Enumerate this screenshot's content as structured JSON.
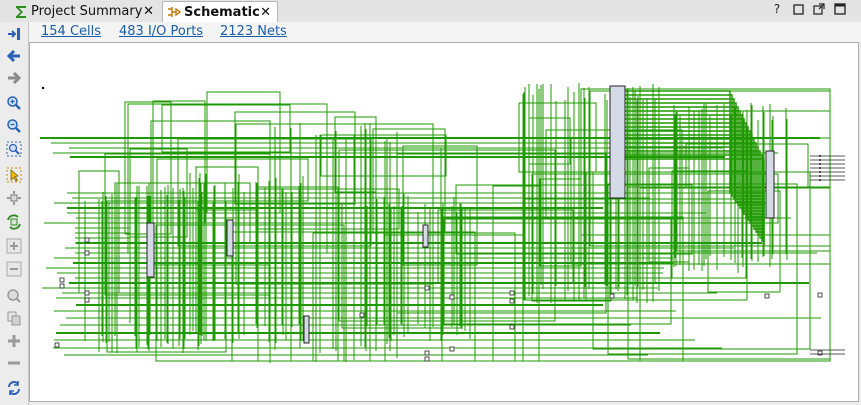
{
  "tabs": [
    {
      "label": "Project Summary",
      "icon": "sigma-icon",
      "close": "✕"
    },
    {
      "label": "Schematic",
      "icon": "schematic-icon",
      "close": "✕"
    }
  ],
  "window_controls": {
    "help": "?"
  },
  "stats": {
    "cells": "154 Cells",
    "ports": "483 I/O Ports",
    "nets": "2123 Nets"
  },
  "toolbar": [
    "fit-to-view-icon",
    "back-arrow-icon",
    "forward-arrow-icon",
    "zoom-in-icon",
    "zoom-out-icon",
    "zoom-fit-icon",
    "select-icon",
    "expand-icon",
    "regenerate-icon",
    "add-icon",
    "remove-icon",
    "search-icon",
    "copy-icon",
    "plus-icon",
    "minus-icon",
    "refresh-icon"
  ],
  "colors": {
    "wire": "#1e9a00",
    "link": "#1a5ea8",
    "cell_fill": "#d4dbe6"
  }
}
